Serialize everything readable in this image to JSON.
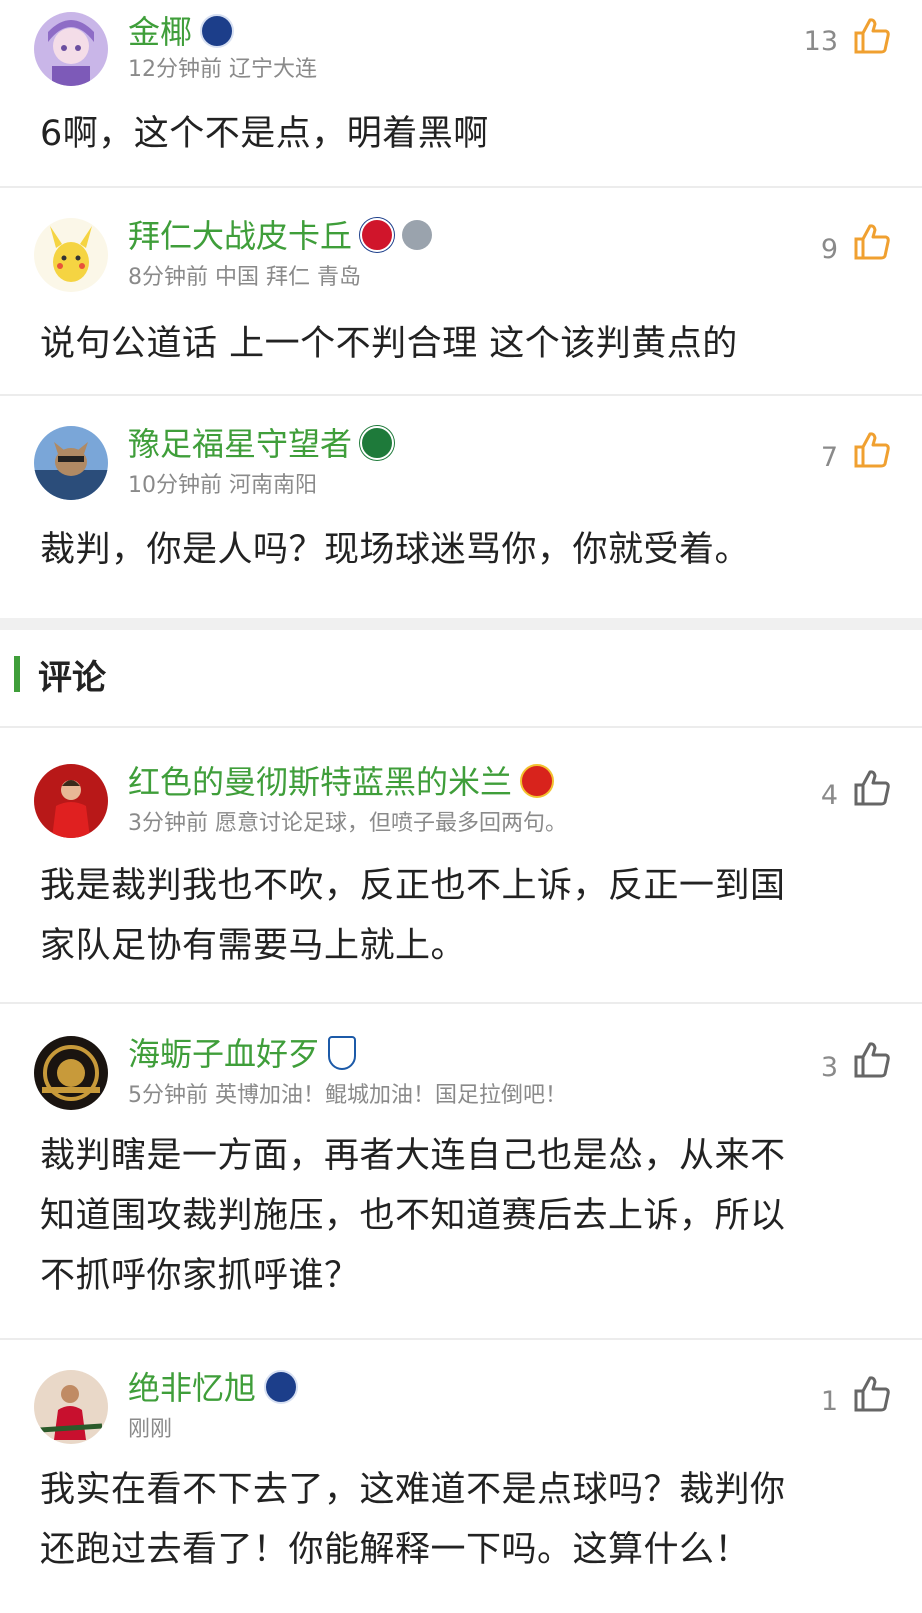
{
  "hot_comments": [
    {
      "username": "金椰",
      "meta": "12分钟前 辽宁大连",
      "likes": "13",
      "text": "6啊，这个不是点，明着黑啊",
      "like_color": "#f0a030"
    },
    {
      "username": "拜仁大战皮卡丘",
      "meta": "8分钟前 中国 拜仁 青岛",
      "likes": "9",
      "text": "说句公道话 上一个不判合理 这个该判黄点的",
      "like_color": "#f0a030"
    },
    {
      "username": "豫足福星守望者",
      "meta": "10分钟前 河南南阳",
      "likes": "7",
      "text": "裁判，你是人吗？现场球迷骂你，你就受着。",
      "like_color": "#f0a030"
    }
  ],
  "section": {
    "title": "评论",
    "accent": "#3f9e3a"
  },
  "comments": [
    {
      "username": "红色的曼彻斯特蓝黑的米兰",
      "meta": "3分钟前 愿意讨论足球，但喷子最多回两句。",
      "likes": "4",
      "text_line1": "我是裁判我也不吹，反正也不上诉，反正一到国",
      "text_line2": "家队足协有需要马上就上。"
    },
    {
      "username": "海蛎子血好歹",
      "meta": "5分钟前 英博加油！鲲城加油！国足拉倒吧！",
      "likes": "3",
      "text_line1": "裁判瞎是一方面，再者大连自己也是怂，从来不",
      "text_line2": "知道围攻裁判施压，也不知道赛后去上诉，所以",
      "text_line3": "不抓呼你家抓呼谁？"
    },
    {
      "username": "绝非忆旭",
      "meta": "刚刚",
      "likes": "1",
      "text_line1": "我实在看不下去了，这难道不是点球吗？裁判你",
      "text_line2": "还跑过去看了！你能解释一下吗。这算什么！"
    }
  ],
  "icons": {
    "like": "thumbs-up-icon",
    "badge": "team-badge-icon"
  },
  "colors": {
    "username": "#3f9e3a",
    "meta": "#8a8a8a",
    "hot_like": "#f0a030",
    "like": "#666666"
  }
}
